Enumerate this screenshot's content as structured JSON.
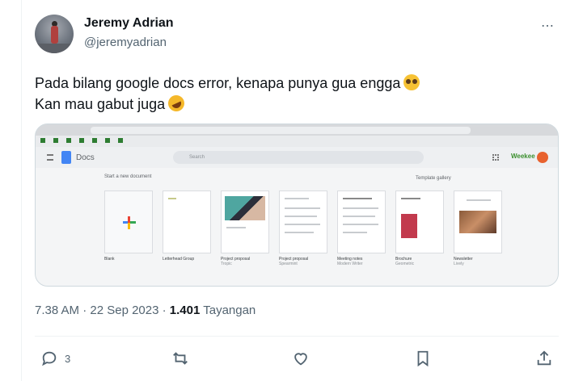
{
  "author": {
    "name": "Jeremy Adrian",
    "handle": "@jeremyadrian"
  },
  "more_icon": "⋯",
  "tweet": {
    "line1": "Pada bilang google docs error, kenapa punya gua engga",
    "line1_emoji": "pleading-face-emoji",
    "line2": "Kan mau gabut juga",
    "line2_emoji": "rolling-on-floor-laughing-emoji"
  },
  "media": {
    "app_title": "Docs",
    "search_placeholder": "Search",
    "start_label": "Start a new document",
    "gallery_label": "Template gallery",
    "brand": "Weekee",
    "templates": [
      {
        "name": "Blank",
        "sub": ""
      },
      {
        "name": "Letterhead Group",
        "sub": ""
      },
      {
        "name": "Project proposal",
        "sub": "Tropic"
      },
      {
        "name": "Project proposal",
        "sub": "Spearmint"
      },
      {
        "name": "Meeting notes",
        "sub": "Modern Writer"
      },
      {
        "name": "Brochure",
        "sub": "Geometric"
      },
      {
        "name": "Newsletter",
        "sub": "Lively"
      }
    ]
  },
  "meta": {
    "time_date": "7.38 AM · 22 Sep 2023 · ",
    "views": "1.401",
    "views_label": " Tayangan"
  },
  "actions": {
    "reply_count": "3",
    "retweet_count": "",
    "like_count": "",
    "bookmark_count": ""
  }
}
